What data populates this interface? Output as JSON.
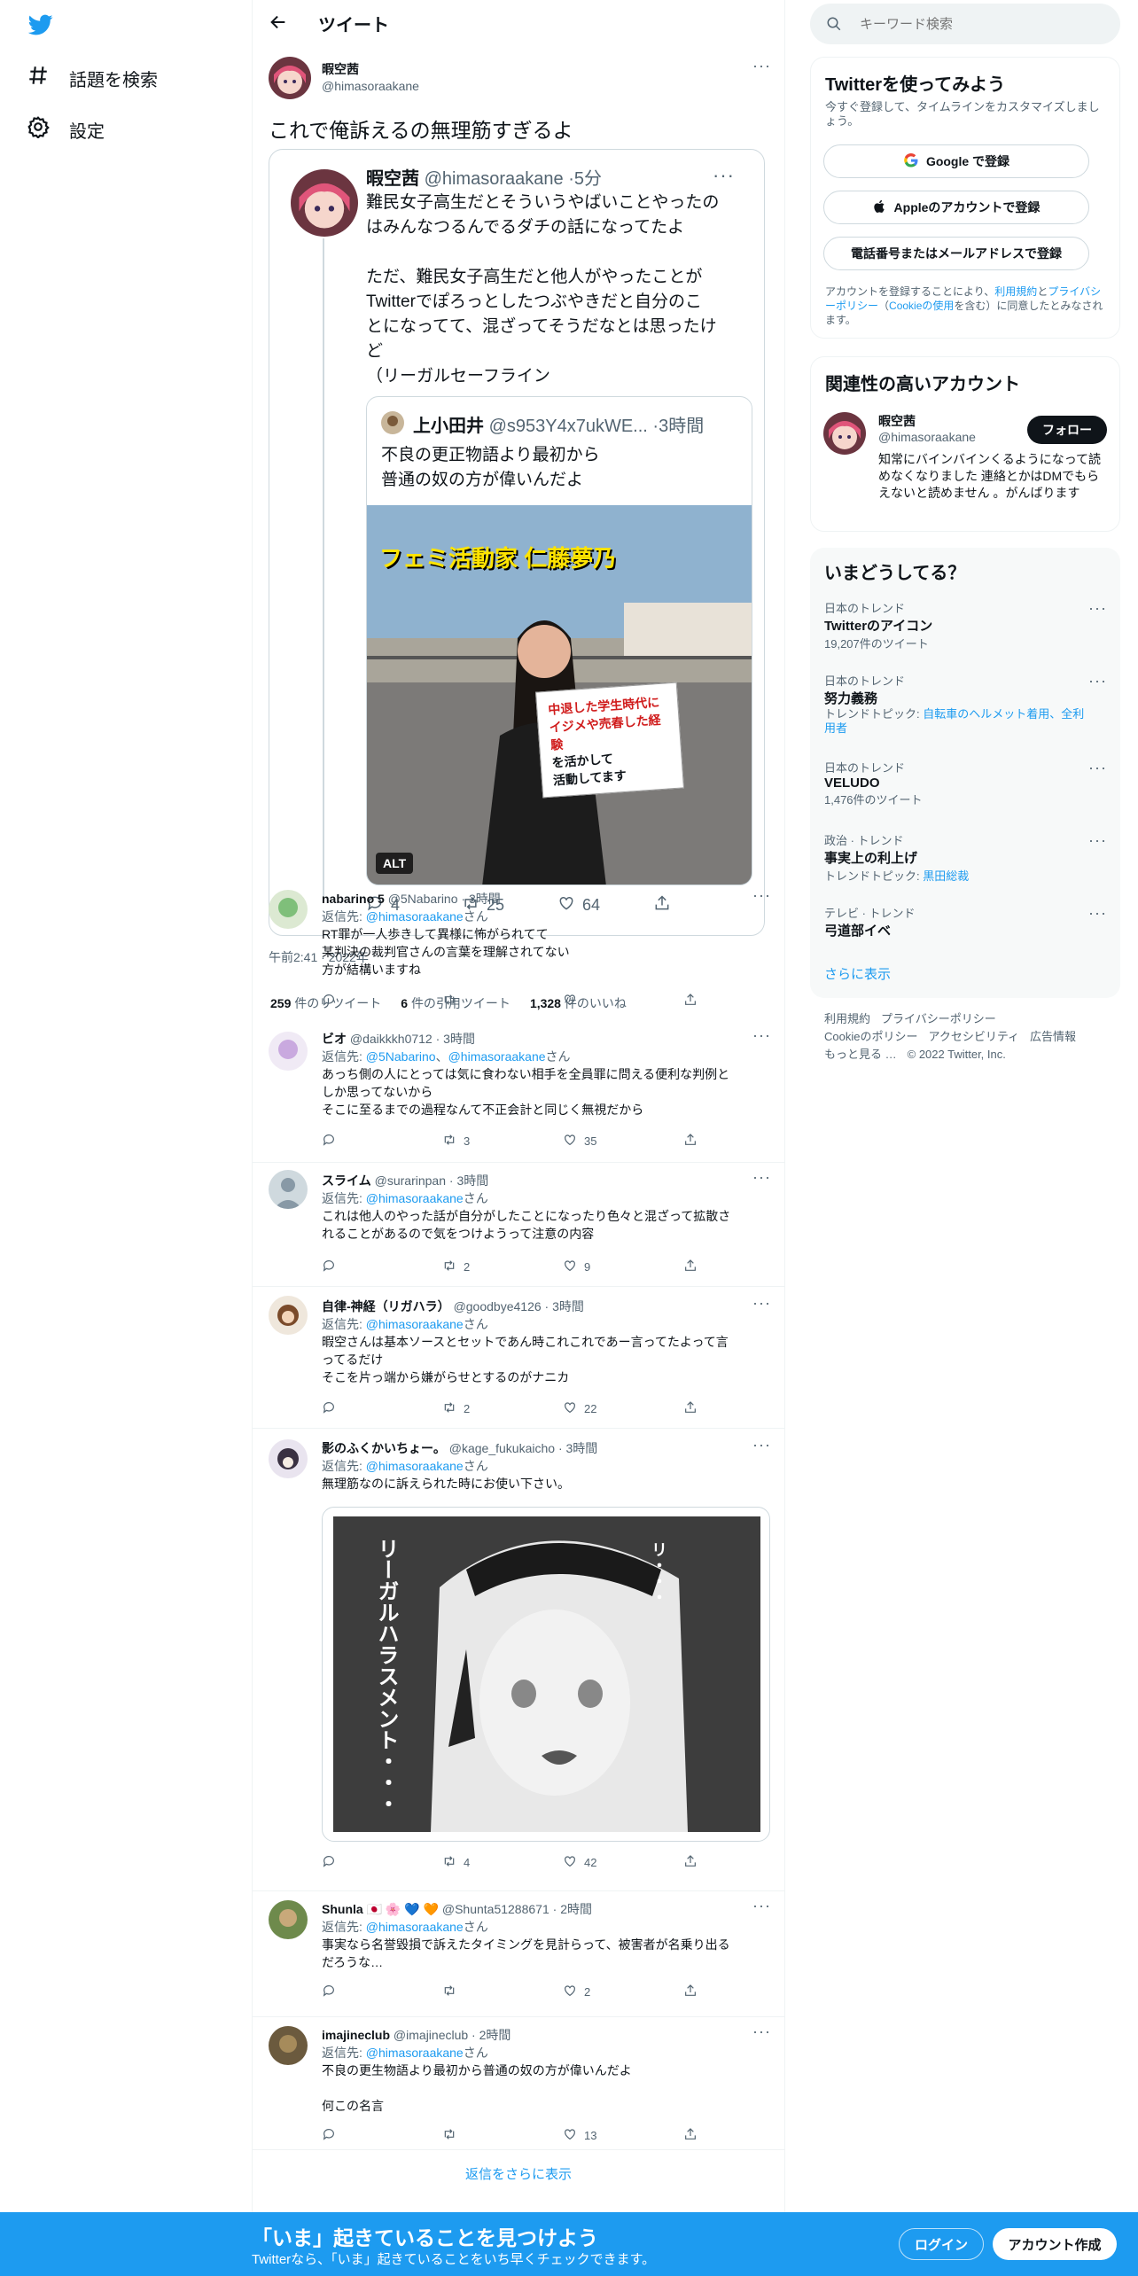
{
  "nav": {
    "explore_label": "話題を検索",
    "settings_label": "設定"
  },
  "header": {
    "title": "ツイート"
  },
  "main_tweet": {
    "name": "暇空茜",
    "handle": "@himasoraakane",
    "text": "これで俺訴えるの無理筋すぎるよ",
    "quote": {
      "name": "暇空茜",
      "handle": "@himasoraakane",
      "time": "5分",
      "text_lines": [
        "難民女子高生だとそういうやばいことやったの",
        "はみんなつるんでるダチの話になってたよ",
        "",
        "ただ、難民女子高生だと他人がやったことが",
        "Twitterでぽろっとしたつぶやきだと自分のこ",
        "とになってて、混ざってそうだなとは思ったけ",
        "ど",
        "（リーガルセーフライン"
      ],
      "inner": {
        "name": "上小田井",
        "handle": "@s953Y4x7ukWE...",
        "time": "3時間",
        "text_lines": [
          "不良の更正物語より最初から",
          "普通の奴の方が偉いんだよ"
        ],
        "image_title": "フェミ活動家 仁藤夢乃",
        "sign_lines": [
          "中退した学生時代に",
          "イジメや売春した経験",
          "を活かして",
          "活動してます"
        ],
        "alt": "ALT"
      },
      "action_counts": [
        "4",
        "25",
        "64"
      ]
    },
    "timestamp": "午前2:41 · 2022年",
    "stats": [
      {
        "count": "259",
        "label": "件のリツイート"
      },
      {
        "count": "6",
        "label": "件の引用ツイート"
      },
      {
        "count": "1,328",
        "label": "件のいいね"
      }
    ]
  },
  "reply_prefix": "返信先: ",
  "reply_suffix": "さん",
  "replies": [
    {
      "name": "nabarino 5",
      "handle": "@5Nabarino",
      "time": "3時間",
      "to": "@himasoraakane",
      "lines": [
        "RT罪が一人歩きして異様に怖がられてて",
        "某判決の裁判官さんの言葉を理解されてない",
        "方が結構いますね"
      ],
      "counts": [
        "",
        "",
        ""
      ]
    },
    {
      "name": "ビオ",
      "handle": "@daikkkh0712",
      "time": "3時間",
      "to": "@5Nabarino",
      "to2": "@himasoraakane",
      "lines": [
        "あっち側の人にとっては気に食わない相手を全員罪に問える便利な判例と",
        "しか思ってないから",
        "そこに至るまでの過程なんて不正会計と同じく無視だから"
      ],
      "counts": [
        "",
        "3",
        "35"
      ]
    },
    {
      "name": "スライム",
      "handle": "@surarinpan",
      "time": "3時間",
      "to": "@himasoraakane",
      "lines": [
        "これは他人のやった話が自分がしたことになったり色々と混ざって拡散さ",
        "れることがあるので気をつけようって注意の内容"
      ],
      "counts": [
        "",
        "2",
        "9"
      ]
    },
    {
      "name": "自律-神経（リガハラ）",
      "handle": "@goodbye4126",
      "time": "3時間",
      "to": "@himasoraakane",
      "lines": [
        "暇空さんは基本ソースとセットであん時これこれであー言ってたよって言",
        "ってるだけ",
        "そこを片っ端から嫌がらせとするのがナニカ"
      ],
      "counts": [
        "",
        "2",
        "22"
      ]
    },
    {
      "name": "影のふくかいちょー。",
      "handle": "@kage_fukukaicho",
      "time": "3時間",
      "to": "@himasoraakane",
      "lines": [
        "無理筋なのに訴えられた時にお使い下さい。"
      ],
      "image_texts": [
        "リーガルハラスメント・・・",
        "リ・・・"
      ],
      "counts": [
        "",
        "4",
        "42"
      ]
    },
    {
      "name": "Shunla 🇯🇵 🌸 💙 🧡",
      "handle": "@Shunta51288671",
      "time": "2時間",
      "to": "@himasoraakane",
      "lines": [
        "事実なら名誉毀損で訴えたタイミングを見計らって、被害者が名乗り出る",
        "だろうな…"
      ],
      "counts": [
        "",
        "",
        "2"
      ]
    },
    {
      "name": "imajineclub",
      "handle": "@imajineclub",
      "time": "2時間",
      "to": "@himasoraakane",
      "lines": [
        "不良の更生物語より最初から普通の奴の方が偉いんだよ",
        "",
        "何この名言"
      ],
      "counts": [
        "",
        "",
        "13"
      ]
    }
  ],
  "show_more_replies": "返信をさらに表示",
  "right": {
    "search_placeholder": "キーワード検索",
    "signup": {
      "title": "Twitterを使ってみよう",
      "desc": "今すぐ登録して、タイムラインをカスタマイズしましょう。",
      "google_btn": "Google で登録",
      "apple_btn": "Appleのアカウントで登録",
      "phone_btn": "電話番号またはメールアドレスで登録",
      "terms_1": "アカウントを登録することにより、",
      "terms_link1": "利用規約",
      "terms_2": "と",
      "terms_link2": "プライバシーポリシー",
      "terms_3": "（",
      "terms_link3": "Cookieの使用",
      "terms_4": "を含む）に同意したとみなされます。"
    },
    "related": {
      "title": "関連性の高いアカウント",
      "name": "暇空茜",
      "handle": "@himasoraakane",
      "follow_btn": "フォロー",
      "bio": "知常にバインバインくるようになって読めなくなりました 連絡とかはDMでもらえないと読めません 。がんばります"
    },
    "trends": {
      "title": "いまどうしてる？",
      "items": [
        {
          "cat": "日本のトレンド",
          "name": "Twitterのアイコン",
          "sub": "19,207件のツイート",
          "sub_link": ""
        },
        {
          "cat": "日本のトレンド",
          "name": "努力義務",
          "sub": "トレンドトピック: ",
          "sub_link": "自転車のヘルメット着用、全利用者"
        },
        {
          "cat": "日本のトレンド",
          "name": "VELUDO",
          "sub": "1,476件のツイート",
          "sub_link": ""
        },
        {
          "cat": "政治 · トレンド",
          "name": "事実上の利上げ",
          "sub": "トレンドトピック: ",
          "sub_link": "黒田総裁"
        },
        {
          "cat": "テレビ · トレンド",
          "name": "弓道部イベ",
          "sub": "",
          "sub_link": ""
        }
      ],
      "show_more": "さらに表示"
    },
    "footer": {
      "line1": [
        "利用規約",
        "プライバシーポリシー"
      ],
      "line2": [
        "Cookieのポリシー",
        "アクセシビリティ",
        "広告情報"
      ],
      "line3_more": "もっと見る …",
      "copyright": "© 2022 Twitter, Inc."
    }
  },
  "bottom_bar": {
    "title": "「いま」起きていることを見つけよう",
    "subtitle": "Twitterなら、「いま」起きていることをいち早くチェックできます。",
    "login": "ログイン",
    "signup": "アカウント作成"
  },
  "colors": {
    "accent": "#1d9bf0",
    "text": "#0f1419",
    "muted": "#536471",
    "border": "#eff3f4"
  }
}
